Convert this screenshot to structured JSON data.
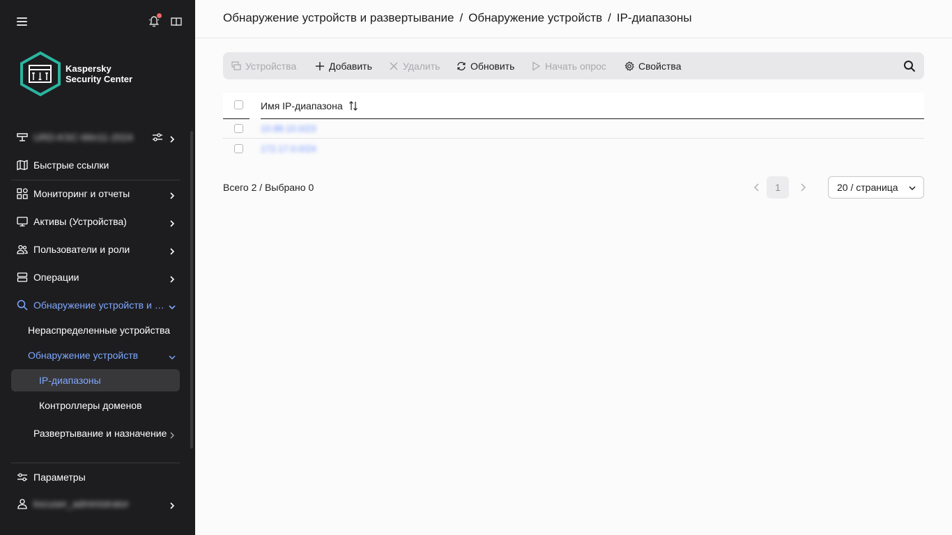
{
  "sidebar": {
    "brand_line1": "Kaspersky",
    "brand_line2": "Security Center",
    "server": "URD-KSC-Win11-2024",
    "items": [
      {
        "label": "Быстрые ссылки",
        "icon": "map-icon"
      },
      {
        "label": "Мониторинг и отчеты",
        "icon": "dashboard-icon"
      },
      {
        "label": "Активы (Устройства)",
        "icon": "monitor-icon"
      },
      {
        "label": "Пользователи и роли",
        "icon": "users-icon"
      },
      {
        "label": "Операции",
        "icon": "server-icon"
      },
      {
        "label": "Обнаружение устройств и развертывание",
        "icon": "search-icon"
      },
      {
        "label": "Нераспределенные устройства"
      },
      {
        "label": "Обнаружение устройств"
      },
      {
        "label": "IP-диапазоны"
      },
      {
        "label": "Контроллеры доменов"
      },
      {
        "label": "Развертывание и назначение"
      }
    ],
    "settings": "Параметры",
    "user": "kscuser_administrator"
  },
  "breadcrumb": [
    "Обнаружение устройств и развертывание",
    "Обнаружение устройств",
    "IP-диапазоны"
  ],
  "breadcrumb_sep": "/",
  "toolbar": {
    "devices": "Устройства",
    "add": "Добавить",
    "delete": "Удалить",
    "refresh": "Обновить",
    "start_poll": "Начать опрос",
    "properties": "Свойства"
  },
  "table": {
    "column": "Имя IP-диапазона",
    "rows": [
      "10.88.10.0/23",
      "172.17.0.0/24"
    ]
  },
  "footer": {
    "total": "Всего 2 / Выбрано 0",
    "page": "1",
    "page_size": "20 / страница"
  },
  "colors": {
    "sidebar_bg": "#1d1d1f",
    "accent": "#7fa8ff",
    "link": "#6f93ff",
    "notification_dot": "#f2686a",
    "logo_teal": "#2bb5a0"
  }
}
